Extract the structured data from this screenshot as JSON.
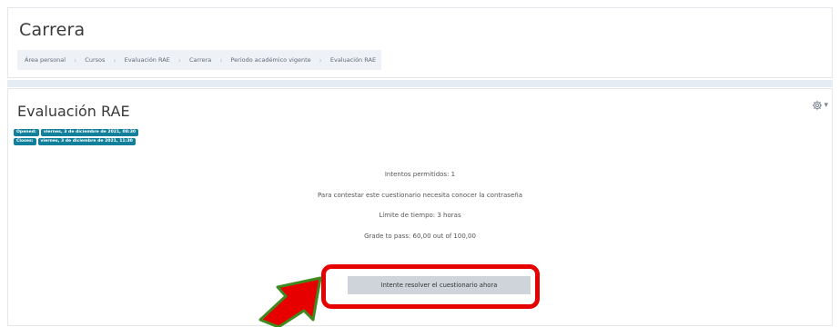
{
  "header": {
    "title": "Carrera",
    "breadcrumb": [
      "Área personal",
      "Cursos",
      "Evaluación RAE",
      "Carrera",
      "Periodo académico vigente",
      "Evaluación RAE"
    ]
  },
  "activity": {
    "title": "Evaluación RAE",
    "settings_icon": "gear-icon",
    "dates": [
      {
        "label": "Opened:",
        "value": "viernes, 3 de diciembre de 2021, 08:30"
      },
      {
        "label": "Closes:",
        "value": "viernes, 3 de diciembre de 2021, 11:30"
      }
    ],
    "info": [
      "Intentos permitidos: 1",
      "Para contestar este cuestionario necesita conocer la contraseña",
      "Límite de tiempo: 3 horas",
      "Grade to pass: 60,00 out of 100,00"
    ],
    "attempt_button": "Intente resolver el cuestionario ahora"
  },
  "colors": {
    "badge": "#12809b",
    "highlight": "#e60000",
    "arrow_fill": "#e60000",
    "arrow_outline": "#3f8a1f",
    "button_bg": "#ced4da"
  }
}
